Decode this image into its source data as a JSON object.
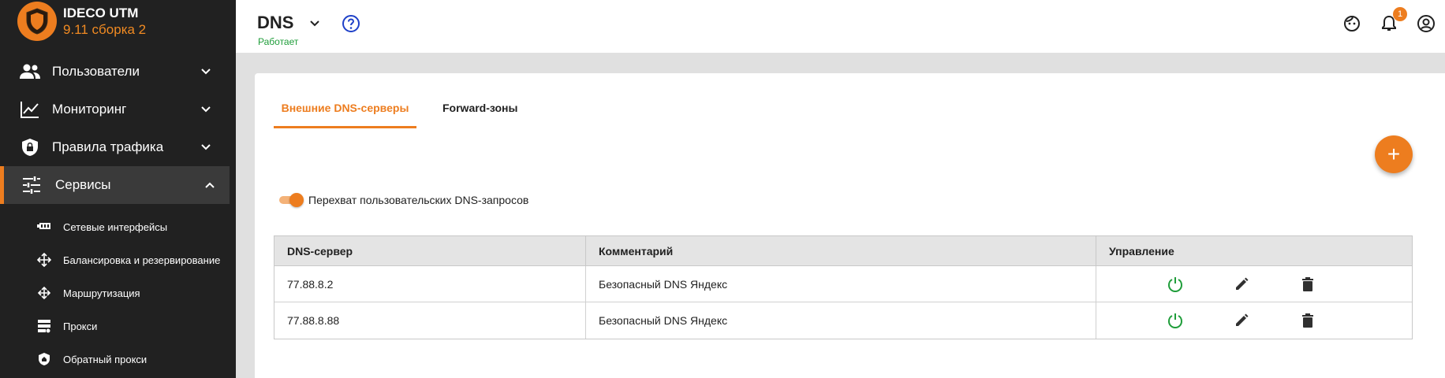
{
  "brand": {
    "title": "IDECO UTM",
    "version": "9.11 сборка 2"
  },
  "sidebar": {
    "items": [
      {
        "label": "Пользователи",
        "icon": "users-icon"
      },
      {
        "label": "Мониторинг",
        "icon": "chart-line-icon"
      },
      {
        "label": "Правила трафика",
        "icon": "shield-lock-icon"
      },
      {
        "label": "Сервисы",
        "icon": "tune-icon",
        "active": true
      }
    ],
    "subitems": [
      {
        "label": "Сетевые интерфейсы",
        "icon": "network-card-icon"
      },
      {
        "label": "Балансировка и резервирование",
        "icon": "arrows-split-icon"
      },
      {
        "label": "Маршрутизация",
        "icon": "move-arrows-icon"
      },
      {
        "label": "Прокси",
        "icon": "server-icon"
      },
      {
        "label": "Обратный прокси",
        "icon": "shield-home-icon"
      }
    ]
  },
  "header": {
    "title": "DNS",
    "status": "Работает",
    "notification_count": "1"
  },
  "tabs": [
    {
      "label": "Внешние DNS-серверы",
      "active": true
    },
    {
      "label": "Forward-зоны",
      "active": false
    }
  ],
  "fab_label": "+",
  "toggle": {
    "label": "Перехват пользовательских DNS-запросов",
    "on": true
  },
  "table": {
    "headers": [
      "DNS-сервер",
      "Комментарий",
      "Управление"
    ],
    "rows": [
      {
        "server": "77.88.8.2",
        "comment": "Безопасный DNS Яндекс"
      },
      {
        "server": "77.88.8.88",
        "comment": "Безопасный DNS Яндекс"
      }
    ]
  },
  "colors": {
    "accent": "#ed7d1f",
    "sidebar_bg": "#212121",
    "status_ok": "#1f9d3a",
    "help": "#1e40c8"
  }
}
